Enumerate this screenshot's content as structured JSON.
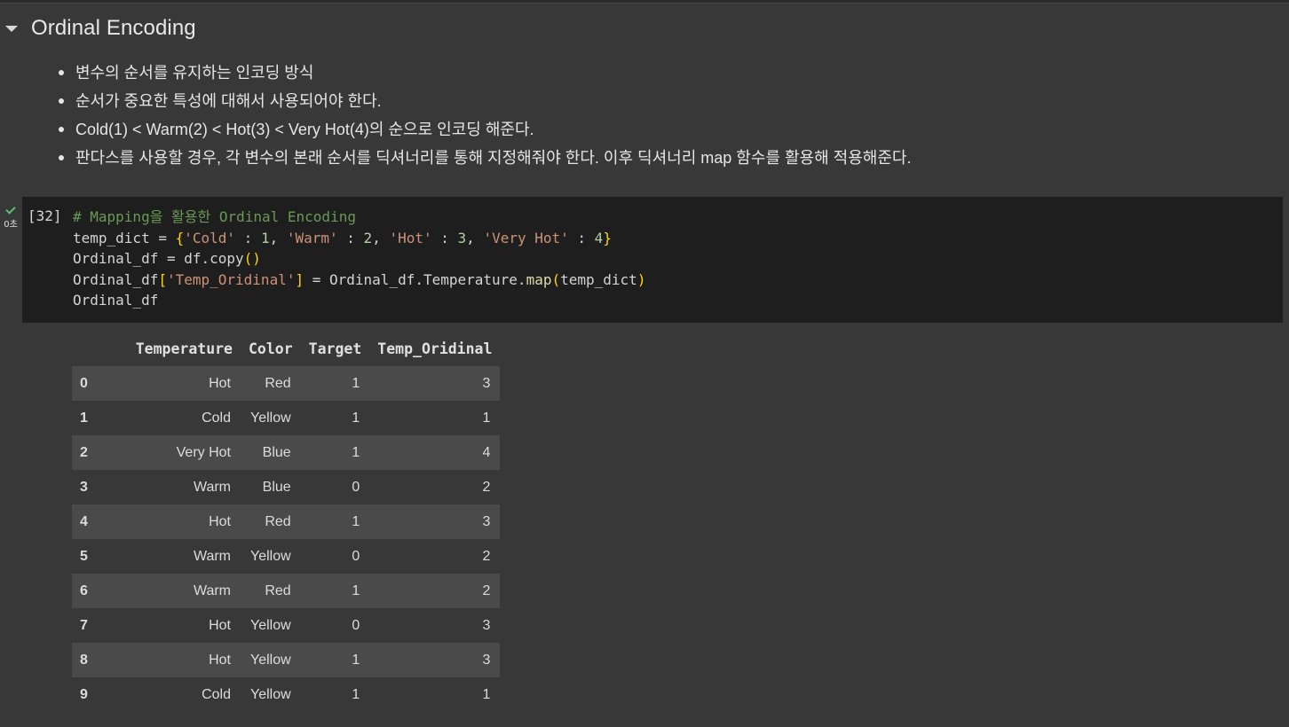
{
  "section": {
    "title": "Ordinal Encoding",
    "bullets": [
      "변수의 순서를 유지하는 인코딩 방식",
      "순서가 중요한 특성에 대해서 사용되어야 한다.",
      "Cold(1) < Warm(2) < Hot(3) < Very Hot(4)의 순으로 인코딩 해준다.",
      "판다스를 사용할 경우, 각 변수의 본래 순서를 딕셔너리를 통해 지정해줘야 한다. 이후 딕셔너리 map 함수를 활용해 적용해준다."
    ]
  },
  "cell": {
    "execution_count": "[32]",
    "run_time": "0초",
    "status": "success",
    "code_lines": [
      "# Mapping을 활용한 Ordinal Encoding",
      "temp_dict = {'Cold' : 1, 'Warm' : 2, 'Hot' : 3, 'Very Hot' : 4}",
      "Ordinal_df = df.copy()",
      "Ordinal_df['Temp_Oridinal'] = Ordinal_df.Temperature.map(temp_dict)",
      "Ordinal_df"
    ]
  },
  "output_table": {
    "columns": [
      "",
      "Temperature",
      "Color",
      "Target",
      "Temp_Oridinal"
    ],
    "rows": [
      [
        "0",
        "Hot",
        "Red",
        "1",
        "3"
      ],
      [
        "1",
        "Cold",
        "Yellow",
        "1",
        "1"
      ],
      [
        "2",
        "Very Hot",
        "Blue",
        "1",
        "4"
      ],
      [
        "3",
        "Warm",
        "Blue",
        "0",
        "2"
      ],
      [
        "4",
        "Hot",
        "Red",
        "1",
        "3"
      ],
      [
        "5",
        "Warm",
        "Yellow",
        "0",
        "2"
      ],
      [
        "6",
        "Warm",
        "Red",
        "1",
        "2"
      ],
      [
        "7",
        "Hot",
        "Yellow",
        "0",
        "3"
      ],
      [
        "8",
        "Hot",
        "Yellow",
        "1",
        "3"
      ],
      [
        "9",
        "Cold",
        "Yellow",
        "1",
        "1"
      ]
    ]
  },
  "colors": {
    "background": "#383838",
    "code_background": "#1e1e1e",
    "success_check": "#5fbf6d",
    "comment": "#6a9955",
    "string": "#ce9178",
    "number": "#b5cea8"
  }
}
